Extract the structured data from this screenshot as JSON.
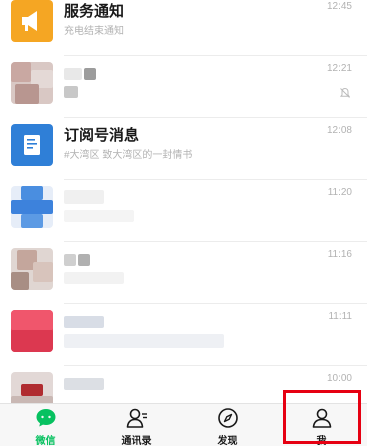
{
  "chats": [
    {
      "title": "服务通知",
      "subtitle": "充电结束通知",
      "time": "12:45",
      "avatar": "service-notice-icon",
      "color": "#f5a623"
    },
    {
      "title": "",
      "subtitle": "",
      "time": "12:21",
      "avatar": "blurred-avatar",
      "muted": true
    },
    {
      "title": "订阅号消息",
      "subtitle": "#大湾区 致大湾区的一封情书",
      "time": "12:08",
      "avatar": "subscription-icon",
      "color": "#2f7fd7"
    },
    {
      "title": "",
      "subtitle": "",
      "time": "11:20",
      "avatar": "blurred-avatar"
    },
    {
      "title": "",
      "subtitle": "",
      "time": "11:16",
      "avatar": "blurred-avatar"
    },
    {
      "title": "",
      "subtitle": "",
      "time": "11:11",
      "avatar": "blurred-avatar"
    },
    {
      "title": "",
      "subtitle": "",
      "time": "10:00",
      "avatar": "blurred-avatar"
    }
  ],
  "tabbar": {
    "tabs": [
      {
        "label": "微信",
        "icon": "chat-bubble-icon",
        "active": true
      },
      {
        "label": "通讯录",
        "icon": "contacts-icon",
        "active": false
      },
      {
        "label": "发现",
        "icon": "compass-icon",
        "active": false
      },
      {
        "label": "我",
        "icon": "person-icon",
        "active": false
      }
    ]
  },
  "colors": {
    "accent": "#07c160",
    "highlight": "#e60012"
  }
}
